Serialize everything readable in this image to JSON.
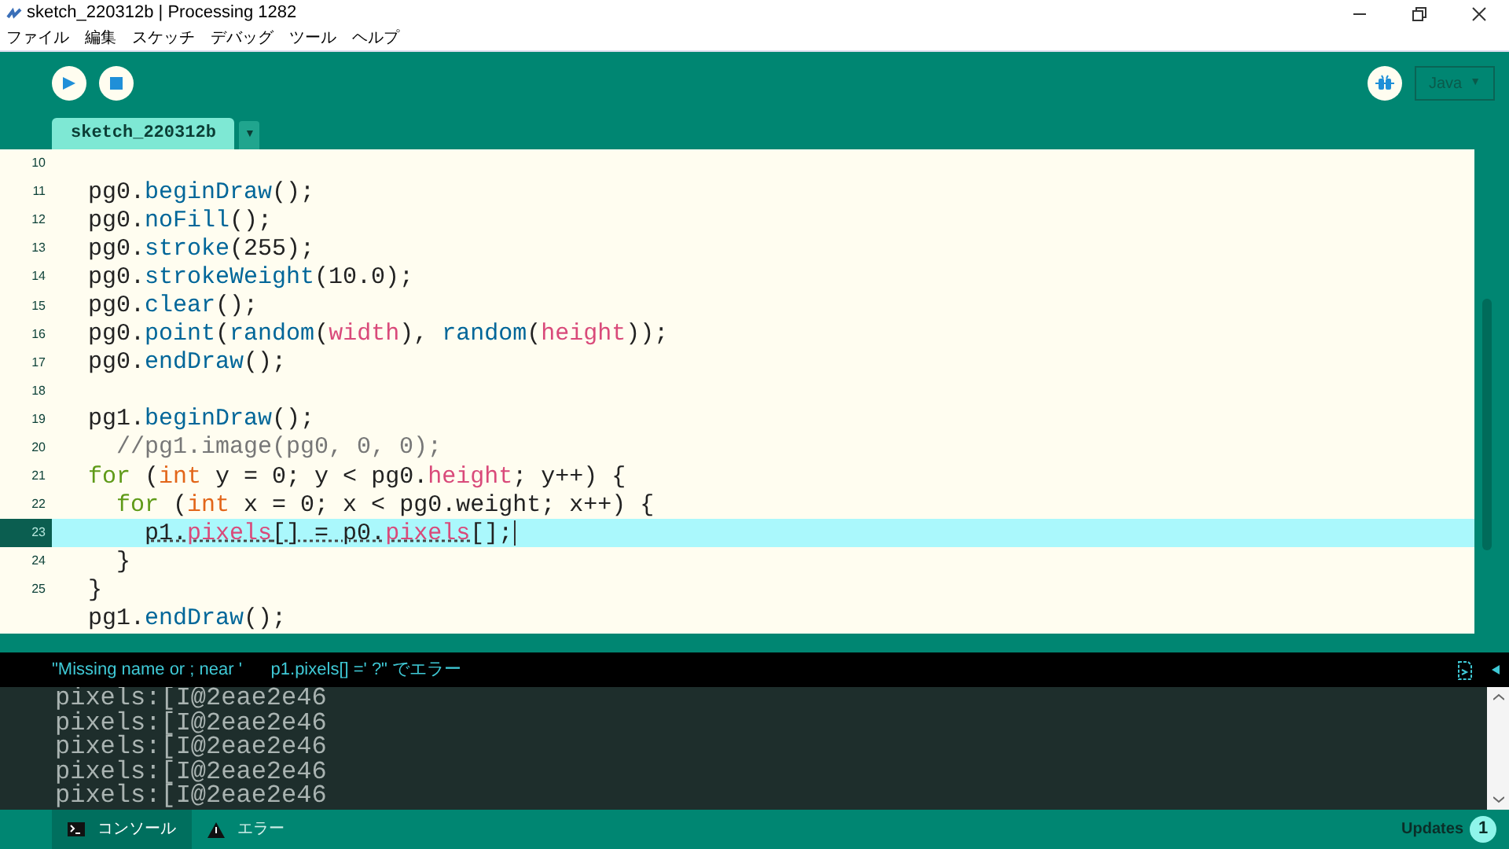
{
  "window": {
    "title": "sketch_220312b | Processing 1282"
  },
  "menu": [
    "ファイル",
    "編集",
    "スケッチ",
    "デバッグ",
    "ツール",
    "ヘルプ"
  ],
  "toolbar": {
    "mode_label": "Java",
    "mode_caret": "▼"
  },
  "tabs": [
    {
      "label": "sketch_220312b",
      "selected": true
    }
  ],
  "tab_menu_caret": "▼",
  "editor": {
    "lines": [
      {
        "number": "10",
        "selected": false
      },
      {
        "number": "11",
        "selected": false,
        "segments": [
          {
            "kind": "plain",
            "text": "pg0."
          },
          {
            "kind": "function",
            "text": "beginDraw"
          },
          {
            "kind": "plain",
            "text": "();"
          }
        ]
      },
      {
        "number": "12",
        "selected": false,
        "segments": [
          {
            "kind": "plain",
            "text": "pg0."
          },
          {
            "kind": "function",
            "text": "noFill"
          },
          {
            "kind": "plain",
            "text": "();"
          }
        ]
      },
      {
        "number": "13",
        "selected": false,
        "segments": [
          {
            "kind": "plain",
            "text": "pg0."
          },
          {
            "kind": "function",
            "text": "stroke"
          },
          {
            "kind": "plain",
            "text": "(255);"
          }
        ]
      },
      {
        "number": "14",
        "selected": false,
        "segments": [
          {
            "kind": "plain",
            "text": "pg0."
          },
          {
            "kind": "function",
            "text": "strokeWeight"
          },
          {
            "kind": "plain",
            "text": "(10.0);"
          }
        ]
      },
      {
        "number": "15",
        "selected": false,
        "segments": [
          {
            "kind": "plain",
            "text": "pg0."
          },
          {
            "kind": "function",
            "text": "clear"
          },
          {
            "kind": "plain",
            "text": "();"
          }
        ]
      },
      {
        "number": "16",
        "selected": false,
        "segments": [
          {
            "kind": "plain",
            "text": "pg0."
          },
          {
            "kind": "function",
            "text": "point"
          },
          {
            "kind": "plain",
            "text": "("
          },
          {
            "kind": "function",
            "text": "random"
          },
          {
            "kind": "plain",
            "text": "("
          },
          {
            "kind": "variable",
            "text": "width"
          },
          {
            "kind": "plain",
            "text": "), "
          },
          {
            "kind": "function",
            "text": "random"
          },
          {
            "kind": "plain",
            "text": "("
          },
          {
            "kind": "variable",
            "text": "height"
          },
          {
            "kind": "plain",
            "text": "));"
          }
        ]
      },
      {
        "number": "17",
        "selected": false,
        "segments": [
          {
            "kind": "plain",
            "text": "pg0."
          },
          {
            "kind": "function",
            "text": "endDraw"
          },
          {
            "kind": "plain",
            "text": "();"
          }
        ]
      },
      {
        "number": "18",
        "selected": false
      },
      {
        "number": "19",
        "selected": false,
        "segments": [
          {
            "kind": "plain",
            "text": "pg1."
          },
          {
            "kind": "function",
            "text": "beginDraw"
          },
          {
            "kind": "plain",
            "text": "();"
          }
        ]
      },
      {
        "number": "20",
        "selected": false,
        "segments": [
          {
            "kind": "comment",
            "text": "  //pg1.image(pg0, 0, 0);"
          }
        ]
      },
      {
        "number": "21",
        "selected": false,
        "segments": [
          {
            "kind": "keyword",
            "text": "for"
          },
          {
            "kind": "plain",
            "text": " ("
          },
          {
            "kind": "type",
            "text": "int"
          },
          {
            "kind": "plain",
            "text": " y = 0; y < pg0."
          },
          {
            "kind": "variable",
            "text": "height"
          },
          {
            "kind": "plain",
            "text": "; y++) {"
          }
        ]
      },
      {
        "number": "22",
        "selected": false,
        "segments": [
          {
            "kind": "keyword",
            "text": "  for"
          },
          {
            "kind": "plain",
            "text": " ("
          },
          {
            "kind": "type",
            "text": "int"
          },
          {
            "kind": "plain",
            "text": " x = 0; x < pg0.weight; x++) {"
          }
        ]
      },
      {
        "number": "23",
        "selected": true,
        "segments": [
          {
            "kind": "plain",
            "text": "    p1.",
            "error": true
          },
          {
            "kind": "variable",
            "text": "pixels",
            "error": true
          },
          {
            "kind": "plain",
            "text": "[] = p0.",
            "error": true
          },
          {
            "kind": "variable",
            "text": "pixels",
            "error": true
          },
          {
            "kind": "plain",
            "text": "[];"
          }
        ]
      },
      {
        "number": "24",
        "selected": false,
        "segments": [
          {
            "kind": "plain",
            "text": "  }"
          }
        ]
      },
      {
        "number": "25",
        "selected": false,
        "segments": [
          {
            "kind": "plain",
            "text": "}"
          }
        ]
      },
      {
        "selected": false,
        "segments": [
          {
            "kind": "plain",
            "text": "pg1."
          },
          {
            "kind": "function",
            "text": "endDraw"
          },
          {
            "kind": "plain",
            "text": "();"
          }
        ]
      }
    ]
  },
  "error_bar": {
    "message": "\"Missing name or ; near '      p1.pixels[] =' ?\" でエラー"
  },
  "console": {
    "lines": [
      "pixels:[I@2eae2e46",
      "pixels:[I@2eae2e46",
      "pixels:[I@2eae2e46",
      "pixels:[I@2eae2e46",
      "pixels:[I@2eae2e46"
    ]
  },
  "bottom_tabs": [
    {
      "kind": "console",
      "label": "コンソール",
      "selected": true
    },
    {
      "kind": "errors",
      "label": "エラー",
      "selected": false
    }
  ],
  "updates": {
    "label": "Updates",
    "count": "1"
  }
}
